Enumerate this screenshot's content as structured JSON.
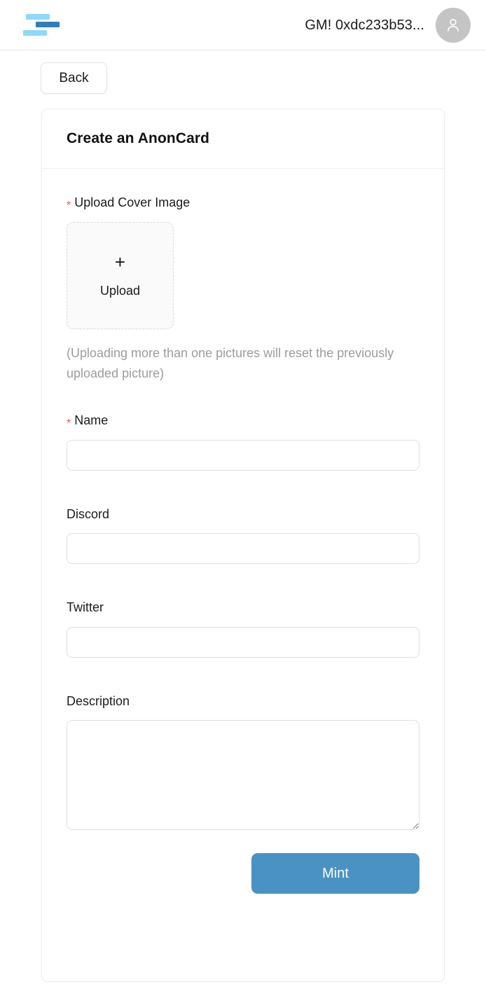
{
  "header": {
    "logo_name": "anoncard-logo",
    "greeting": "GM! 0xdc233b53...",
    "avatar_icon": "user-avatar-icon"
  },
  "nav": {
    "back_label": "Back"
  },
  "card": {
    "title": "Create an AnonCard"
  },
  "form": {
    "upload": {
      "required_marker": "*",
      "label": "Upload Cover Image",
      "plus_icon": "+",
      "button_text": "Upload",
      "hint": "(Uploading more than one pictures will reset the previously uploaded picture)"
    },
    "name": {
      "required_marker": "*",
      "label": "Name",
      "value": "",
      "placeholder": ""
    },
    "discord": {
      "label": "Discord",
      "value": "",
      "placeholder": ""
    },
    "twitter": {
      "label": "Twitter",
      "value": "",
      "placeholder": ""
    },
    "description": {
      "label": "Description",
      "value": "",
      "placeholder": ""
    },
    "submit_label": "Mint"
  },
  "colors": {
    "accent_blue": "#4a92c4",
    "logo_light_blue": "#8ed8fb",
    "logo_dark_blue": "#2f7fb8",
    "required_red": "#ff4d4f",
    "hint_gray": "#9c9c9c"
  }
}
